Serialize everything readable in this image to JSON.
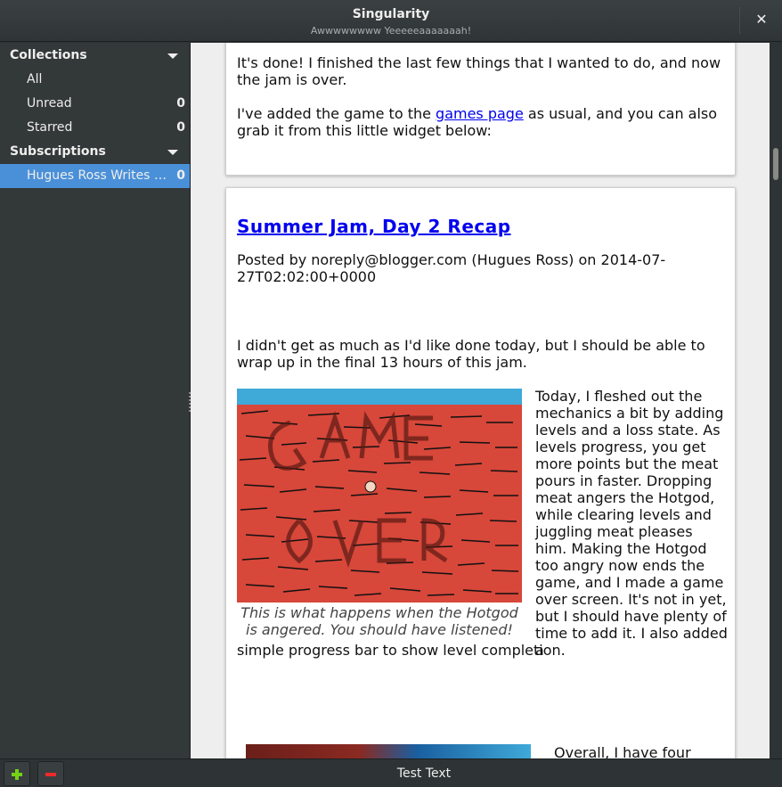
{
  "window": {
    "title": "Singularity",
    "subtitle": "Awwwwwwww Yeeeeeaaaaaaah!",
    "close_glyph": "✕"
  },
  "sidebar": {
    "collections": {
      "label": "Collections",
      "items": [
        {
          "label": "All",
          "count": ""
        },
        {
          "label": "Unread",
          "count": "0"
        },
        {
          "label": "Starred",
          "count": "0"
        }
      ]
    },
    "subscriptions": {
      "label": "Subscriptions",
      "items": [
        {
          "label": "Hugues Ross Writes a …",
          "count": "0"
        }
      ]
    }
  },
  "feed": {
    "post1": {
      "p1": "It's done! I finished the last few things that I wanted to do, and now the jam is over.",
      "p2_before": "I've added the game to the ",
      "p2_link": "games page",
      "p2_after": " as usual, and you can also grab it from this little widget below:"
    },
    "post2": {
      "title": "Summer Jam, Day 2 Recap",
      "meta": "Posted by noreply@blogger.com (Hugues Ross) on 2014-07-27T02:02:00+0000",
      "p1": "I didn't get as much as I'd like done today, but I should be able to wrap up in the final 13 hours of this jam.",
      "image_caption": "This is what happens when the Hotgod is angered. You should have listened!",
      "side_text": "Today, I fleshed out the mechanics a bit by adding levels and a loss state. As levels progress, you get more points but the meat pours in faster. Dropping meat angers the Hotgod, while clearing levels and juggling meat pleases him. Making the Hotgod too angry now ends the game, and I made a game over screen. It's not in yet, but I should have plenty of time to add it. I also added a",
      "tail_text": "simple progress bar to show level completion.",
      "overall_text": "Overall, I have four"
    }
  },
  "statusbar": {
    "text": "Test Text",
    "add_icon": "plus-icon",
    "remove_icon": "minus-icon"
  },
  "colors": {
    "selection": "#4a90d9",
    "link": "#0000ee",
    "add": "#73d216",
    "remove": "#ef2929"
  }
}
